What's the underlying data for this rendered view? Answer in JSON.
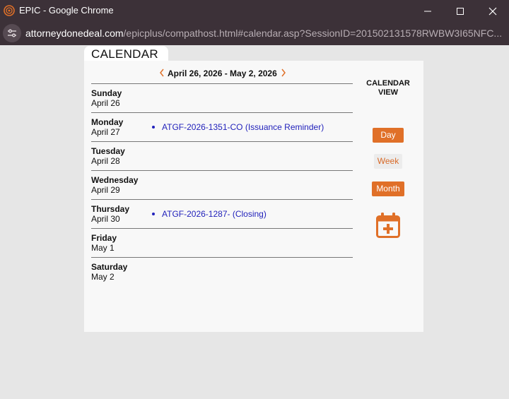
{
  "window": {
    "title": "EPIC - Google Chrome",
    "minimize_icon": "minimize-icon",
    "maximize_icon": "maximize-icon",
    "close_icon": "close-icon"
  },
  "address": {
    "host": "attorneydonedeal.com",
    "path": "/epicplus/compathost.html#calendar.asp?SessionID=201502131578RWBW3I65NFC..."
  },
  "calendar": {
    "tab_label": "CALENDAR",
    "range_label": "April 26, 2026 - May 2, 2026",
    "days": [
      {
        "name": "Sunday",
        "date": "April 26",
        "event": ""
      },
      {
        "name": "Monday",
        "date": "April 27",
        "event": "ATGF-2026-1351-CO (Issuance Reminder)"
      },
      {
        "name": "Tuesday",
        "date": "April 28",
        "event": ""
      },
      {
        "name": "Wednesday",
        "date": "April 29",
        "event": ""
      },
      {
        "name": "Thursday",
        "date": "April 30",
        "event": "ATGF-2026-1287- (Closing)"
      },
      {
        "name": "Friday",
        "date": "May 1",
        "event": ""
      },
      {
        "name": "Saturday",
        "date": "May 2",
        "event": ""
      }
    ],
    "view": {
      "title_line1": "CALENDAR",
      "title_line2": "VIEW",
      "day_label": "Day",
      "week_label": "Week",
      "month_label": "Month"
    }
  },
  "colors": {
    "accent": "#e07028",
    "link": "#2222bb",
    "titlebar": "#3c3138"
  }
}
